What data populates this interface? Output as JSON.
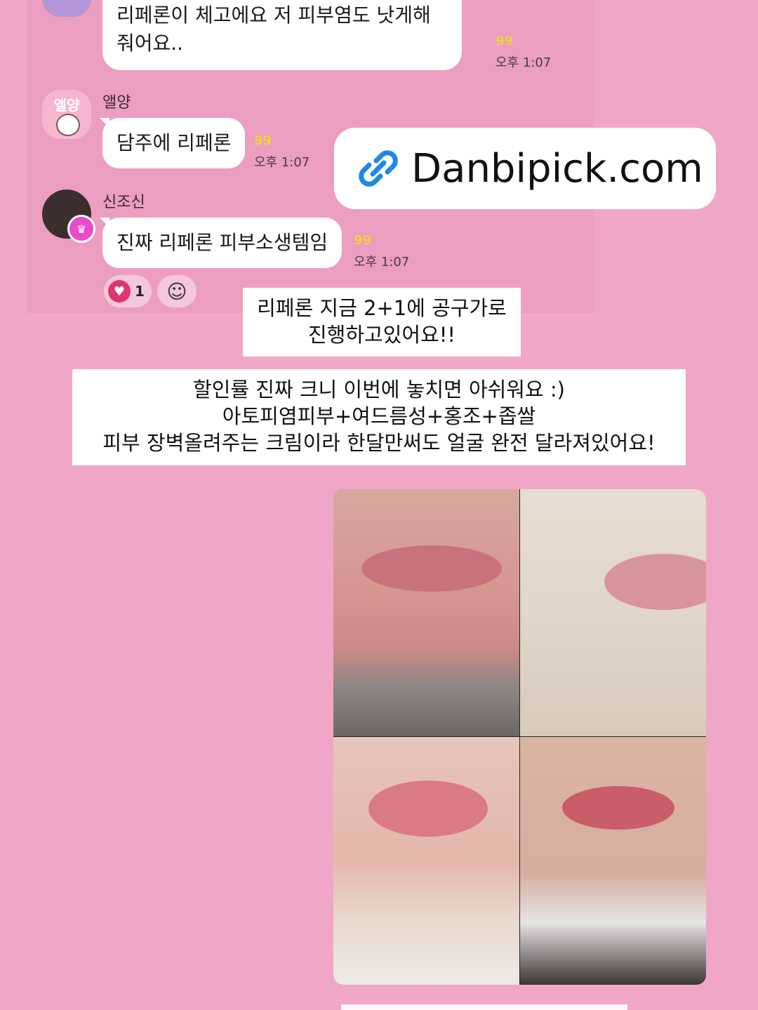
{
  "messages": [
    {
      "author": "",
      "text": "리페론이 체고에요 저 피부염도 낫게해줘어요..",
      "count": "99",
      "time": "오후 1:07"
    },
    {
      "author": "앨양",
      "avatar_text": "앨양",
      "text": "담주에 리페론",
      "count": "99",
      "time": "오후 1:07"
    },
    {
      "author": "신조신",
      "text": "진짜 리페론 피부소생템임",
      "count": "99",
      "time": "오후 1:07"
    }
  ],
  "reaction": {
    "icon": "heart-icon",
    "count": "1"
  },
  "link_card": {
    "icon": "link-icon",
    "text": "Danbipick.com"
  },
  "captions": {
    "line1": "리페론 지금 2+1에 공구가로",
    "line2": "진행하고있어요!!",
    "line3": "할인률 진짜 크니 이번에 놓치면 아쉬워요 :)",
    "line4": "아토피염피부+여드름성+홍조+좁쌀",
    "line5": "피부 장벽올려주는 크림이라 한달만써도 얼굴 완전 달라져있어요!"
  },
  "colors": {
    "background": "#f0a7c7",
    "chat_panel": "#ec9ec1",
    "unread": "#f2d13b",
    "heart": "#e0356f",
    "link": "#1e88e5"
  }
}
